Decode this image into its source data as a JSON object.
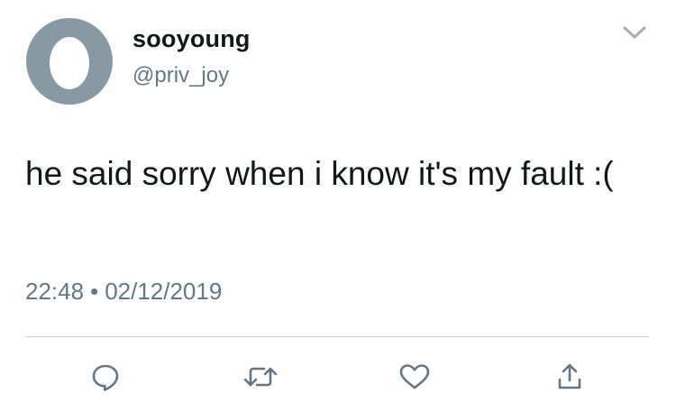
{
  "user": {
    "display_name": "sooyoung",
    "handle": "@priv_joy",
    "avatar_icon": "default-egg-avatar",
    "avatar_bg": "#8899a6"
  },
  "tweet": {
    "text": "he said sorry when i know it's my fault :(",
    "time": "22:48",
    "separator": "•",
    "date": "02/12/2019"
  },
  "actions": [
    {
      "name": "reply",
      "icon": "speech-bubble-icon"
    },
    {
      "name": "retweet",
      "icon": "retweet-arrows-icon"
    },
    {
      "name": "like",
      "icon": "heart-icon"
    },
    {
      "name": "share",
      "icon": "share-upload-icon"
    }
  ],
  "menu": {
    "icon": "chevron-down-icon"
  },
  "colors": {
    "primary_text": "#14171a",
    "secondary_text": "#657786",
    "icon": "#657786",
    "divider": "#ccd6dd"
  }
}
